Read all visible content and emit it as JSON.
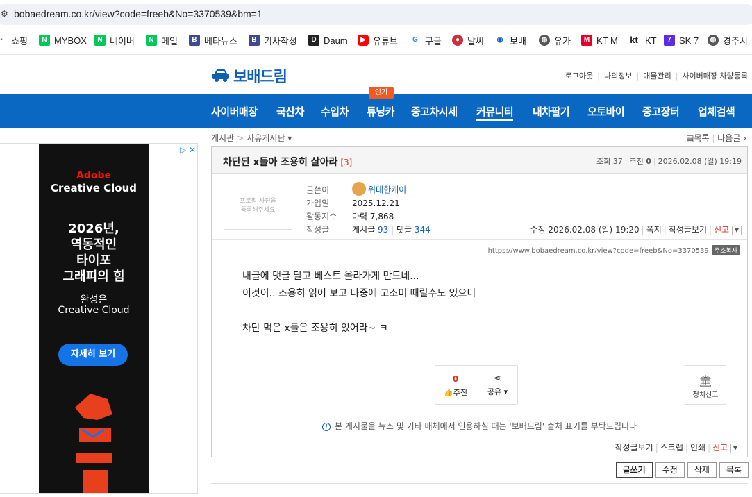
{
  "browser": {
    "url": "bobaedream.co.kr/view?code=freeb&No=3370539&bm=1"
  },
  "bookmarks": [
    {
      "label": "쇼핑",
      "icon": "shopping-icon",
      "color": "#7b5cd6"
    },
    {
      "label": "MYBOX",
      "icon": "naver-icon",
      "color": "#03c75a"
    },
    {
      "label": "네이버",
      "icon": "naver-icon",
      "color": "#03c75a"
    },
    {
      "label": "메일",
      "icon": "naver-icon",
      "color": "#03c75a"
    },
    {
      "label": "베타뉴스",
      "icon": "betanews-icon",
      "color": "#3d4a8f"
    },
    {
      "label": "기사작성",
      "icon": "betanews-icon",
      "color": "#3d4a8f"
    },
    {
      "label": "Daum",
      "icon": "daum-icon",
      "color": "#222222"
    },
    {
      "label": "유튜브",
      "icon": "youtube-icon",
      "color": "#ff0000"
    },
    {
      "label": "구글",
      "icon": "google-icon",
      "color": "#4285f4"
    },
    {
      "label": "날씨",
      "icon": "korea-flag-icon",
      "color": "#cd2e3a"
    },
    {
      "label": "보배",
      "icon": "bobae-icon",
      "color": "#0d5fb4"
    },
    {
      "label": "유가",
      "icon": "globe-icon",
      "color": "#555555"
    },
    {
      "label": "KT M",
      "icon": "ktm-icon",
      "color": "#e4002b"
    },
    {
      "label": "KT",
      "icon": "kt-icon",
      "color": "#222222"
    },
    {
      "label": "SK 7",
      "icon": "sk7-icon",
      "color": "#5b2ce0"
    },
    {
      "label": "경주시",
      "icon": "globe-icon",
      "color": "#555555"
    }
  ],
  "site": {
    "logo": "보배드림",
    "util_links": [
      "로그아웃",
      "나의정보",
      "매물관리",
      "사이버매장 차량등록"
    ],
    "nav": [
      "사이버매장",
      "국산차",
      "수입차",
      "튜닝카",
      "중고차시세",
      "커뮤니티",
      "내차팔기",
      "오토바이",
      "중고장터",
      "업체검색"
    ],
    "nav_badge": "인기",
    "accent": "#0a68c2"
  },
  "ad": {
    "brand1": "Adobe",
    "brand2": "Creative Cloud",
    "headline": [
      "2026년,",
      "역동적인",
      "타이포",
      "그래피의 힘"
    ],
    "sub": [
      "완성은",
      "Creative Cloud"
    ],
    "cta": "자세히 보기"
  },
  "crumb": {
    "board": "게시판",
    "sub": "자유게시판"
  },
  "toplinks": {
    "list": "목록",
    "next": "다음글"
  },
  "post": {
    "title": "차단된 x들아 조용히 살아라",
    "comment_count": "[3]",
    "stats": {
      "views_label": "조회",
      "views": "37",
      "rec_label": "추천",
      "rec": "0",
      "date": "2026.02.08 (일) 19:19"
    },
    "profile_placeholder": [
      "프로필 사진을",
      "등록해주세요"
    ],
    "author_label": "글쓴이",
    "author": "위대한케이",
    "join_label": "가입일",
    "join": "2025.12.21",
    "activity_label": "활동지수",
    "activity": "마력 7,868",
    "writes_label": "작성글",
    "posts_label": "게시글",
    "posts": "93",
    "comments_label": "댓글",
    "comments": "344",
    "edited": "수정 2026.02.08 (일) 19:20",
    "meta_links": [
      "쪽지",
      "작성글보기",
      "신고"
    ],
    "url": "https://www.bobaedream.co.kr/view?code=freeb&No=3370539",
    "copy_label": "주소복사",
    "body": [
      "내글에 댓글 달고 베스트 올라가게 만드네...",
      "이것이.. 조용히 읽어 보고 나중에 고소미 때릴수도 있으니",
      "",
      "차단 먹은 x들은 조용히 있어라~ ㅋ"
    ],
    "recommend_count": "0",
    "recommend_label": "추천",
    "share_label": "공유",
    "report_label": "정치신고",
    "notice": "본 게시물을 뉴스 및 기타 매체에서 인용하실 때는 '보배드림' 출처 표기를 부탁드립니다",
    "bottom_links": [
      "작성글보기",
      "스크랩",
      "인쇄",
      "신고"
    ]
  },
  "actions": [
    "글쓰기",
    "수정",
    "삭제",
    "목록"
  ]
}
